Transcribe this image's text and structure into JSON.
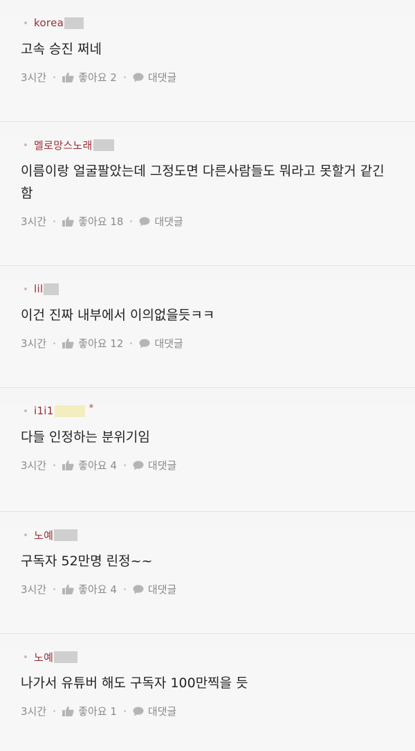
{
  "colors": {
    "author": "#9c2b34",
    "text": "#222222",
    "meta": "#8a8a8a",
    "background": "#f7f7f7",
    "divider": "#e2e2e2",
    "mask_gray": "#cfcfcf",
    "mask_yellow": "#f3edc0"
  },
  "labels": {
    "like": "좋아요",
    "reply": "대댓글"
  },
  "comments": [
    {
      "author": "korea",
      "body": "고속 승진 쩌네",
      "time": "3시간",
      "likes": "2"
    },
    {
      "author": "멜로망스노래",
      "body": "이름이랑 얼굴팔았는데 그정도면 다른사람들도 뭐라고 못할거 같긴함",
      "time": "3시간",
      "likes": "18"
    },
    {
      "author": "lil",
      "body": "이건 진짜 내부에서 이의없을듯ㅋㅋ",
      "time": "3시간",
      "likes": "12"
    },
    {
      "author": "i1i1",
      "author_mark": "*",
      "body": "다들 인정하는 분위기임",
      "time": "3시간",
      "likes": "4"
    },
    {
      "author": "노예",
      "body": "구독자 52만명 린정~~",
      "time": "3시간",
      "likes": "4"
    },
    {
      "author": "노예",
      "body": "나가서 유튜버 해도 구독자 100만찍을 듯",
      "time": "3시간",
      "likes": "1"
    }
  ]
}
